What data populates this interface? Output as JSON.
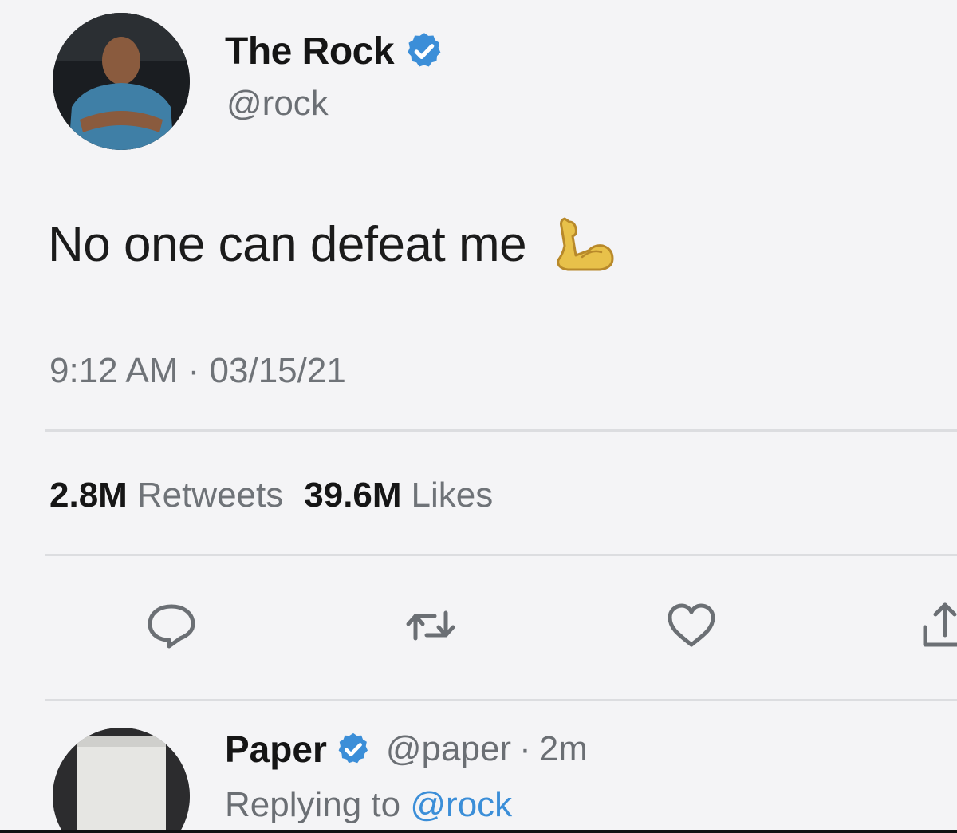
{
  "tweet": {
    "display_name": "The Rock",
    "handle": "@rock",
    "text": "No one can defeat me",
    "emoji_icon": "flexed-biceps-icon",
    "timestamp": "9:12 AM · 03/15/21",
    "stats": {
      "retweets_count": "2.8M",
      "retweets_label": "Retweets",
      "likes_count": "39.6M",
      "likes_label": "Likes"
    },
    "actions": [
      "reply-icon",
      "retweet-icon",
      "like-icon",
      "share-icon"
    ]
  },
  "reply": {
    "display_name": "Paper",
    "handle": "@paper",
    "separator": "·",
    "time": "2m",
    "replying_prefix": "Replying to",
    "replying_handle": "@rock"
  },
  "colors": {
    "verified_blue": "#3b8ed8",
    "secondary_text": "#6b6f74",
    "background": "#f4f4f6",
    "emoji_yellow": "#e8c14a"
  }
}
